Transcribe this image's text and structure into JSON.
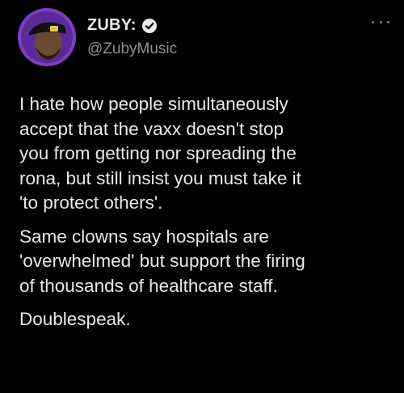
{
  "user": {
    "display_name": "ZUBY:",
    "handle": "@ZubyMusic",
    "verified": true,
    "avatar_ring_color": "#7a3fc4"
  },
  "menu_icon": "more-horizontal-icon",
  "tweet": {
    "paragraphs": [
      "I hate how people simultaneously\naccept that the vaxx doesn't stop\nyou from getting nor spreading the\nrona, but still insist you must take it\n'to protect others'.",
      "Same clowns say hospitals are\n'overwhelmed' but support the firing\nof thousands of healthcare staff.",
      "Doublespeak."
    ]
  },
  "colors": {
    "background": "#000000",
    "text": "#e7e9ea",
    "muted": "#8b9197"
  }
}
